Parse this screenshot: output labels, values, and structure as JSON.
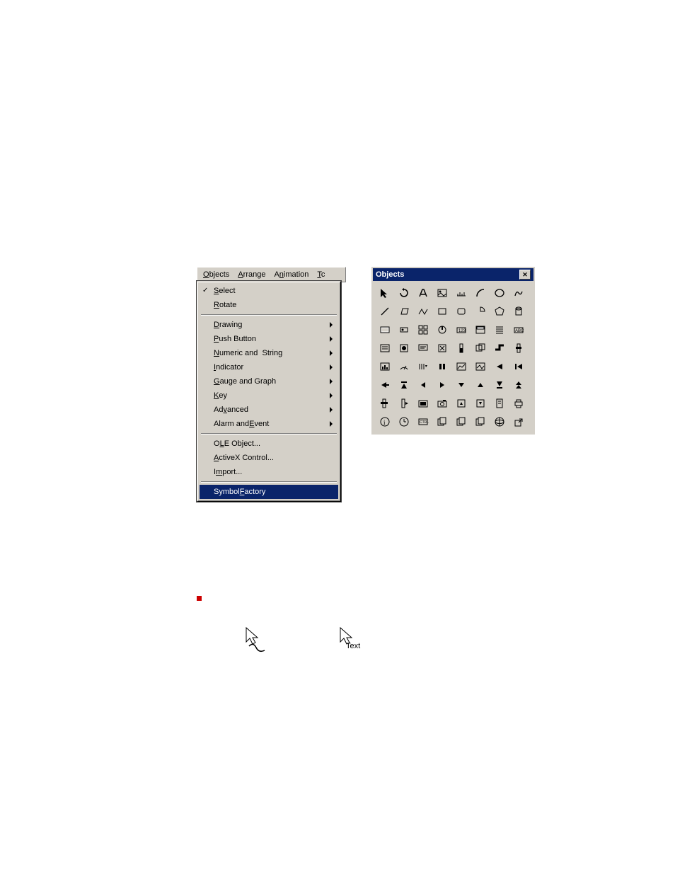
{
  "menubar": {
    "objects": "Objects",
    "arrange": "Arrange",
    "animation": "Animation",
    "tc": "Tc"
  },
  "menu": {
    "select": "Select",
    "rotate": "Rotate",
    "drawing": "Drawing",
    "pushbutton": "Push Button",
    "numstr": "Numeric and  String",
    "indicator": "Indicator",
    "gauge": "Gauge and Graph",
    "key": "Key",
    "advanced": "Advanced",
    "alarm": "Alarm and Event",
    "ole": "OLE Object...",
    "activex": "ActiveX Control...",
    "import": "Import...",
    "symbol": "Symbol Factory"
  },
  "palette": {
    "title": "Objects"
  },
  "cursor": {
    "text": "Text"
  }
}
